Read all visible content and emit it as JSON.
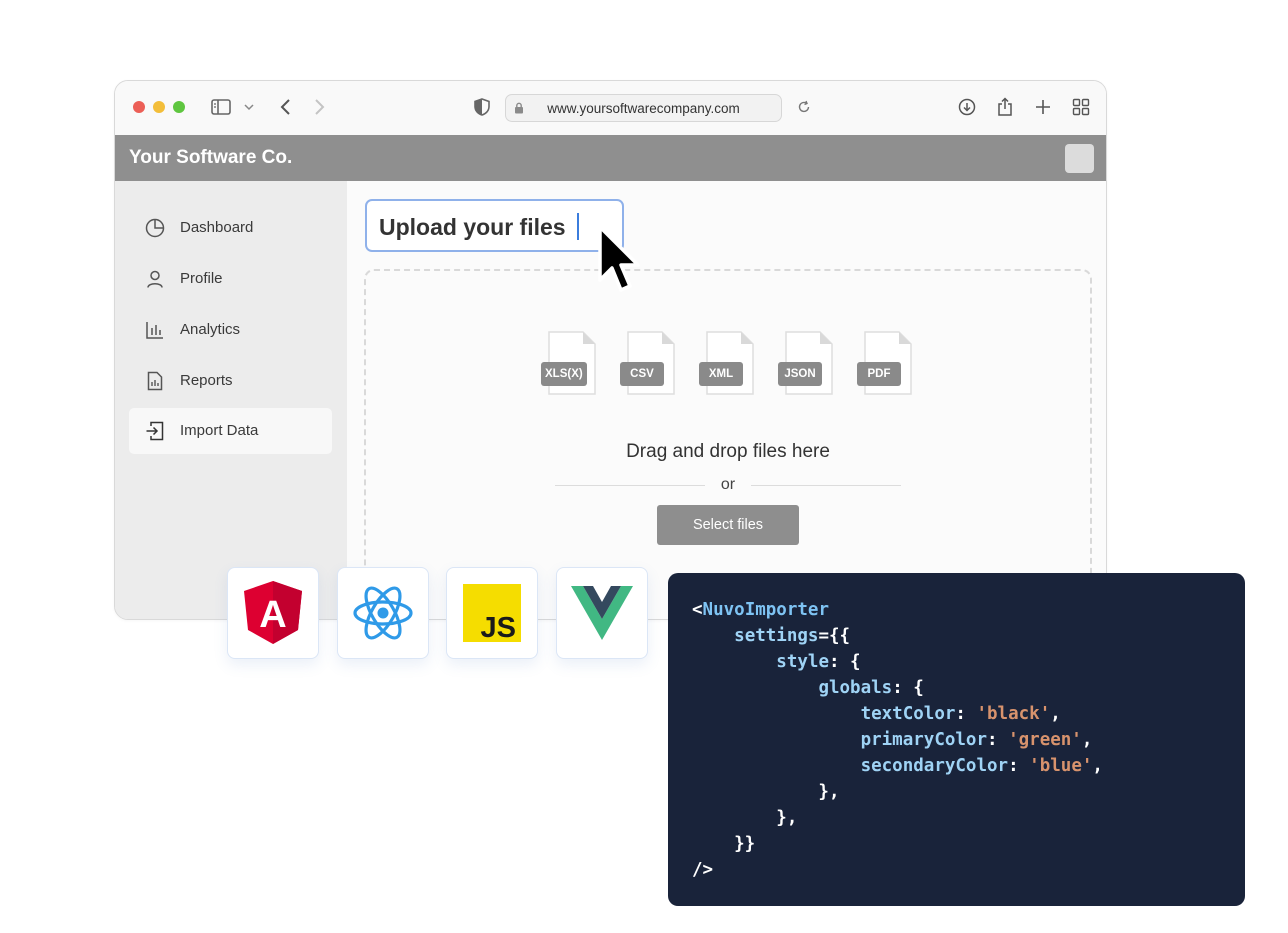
{
  "browser": {
    "url": "www.yoursoftwarecompany.com"
  },
  "app": {
    "brand": "Your Software Co."
  },
  "sidebar": {
    "items": [
      {
        "label": "Dashboard",
        "icon": "pie-chart-icon",
        "active": false
      },
      {
        "label": "Profile",
        "icon": "user-icon",
        "active": false
      },
      {
        "label": "Analytics",
        "icon": "bar-chart-icon",
        "active": false
      },
      {
        "label": "Reports",
        "icon": "report-icon",
        "active": false
      },
      {
        "label": "Import Data",
        "icon": "import-icon",
        "active": true
      }
    ]
  },
  "main": {
    "title": "Upload your files",
    "file_types": [
      "XLS(X)",
      "CSV",
      "XML",
      "JSON",
      "PDF"
    ],
    "dropzone_text": "Drag and drop files here",
    "or_text": "or",
    "select_button": "Select files"
  },
  "frameworks": [
    {
      "name": "angular-logo-icon",
      "label": "A"
    },
    {
      "name": "react-logo-icon",
      "label": ""
    },
    {
      "name": "javascript-logo-icon",
      "label": "JS"
    },
    {
      "name": "vue-logo-icon",
      "label": ""
    }
  ],
  "code": {
    "lines": [
      "<NuvoImporter",
      "    settings={{",
      "        style: {",
      "            globals: {",
      "                textColor: 'black',",
      "                primaryColor: 'green',",
      "                secondaryColor: 'blue',",
      "            },",
      "        },",
      "    }}",
      "/>"
    ]
  },
  "colors": {
    "appbar": "#8f8f8f",
    "code_bg": "#19233a",
    "focus_border": "#8fb1ea",
    "string": "#d8936d",
    "tag": "#7ec3f3"
  }
}
